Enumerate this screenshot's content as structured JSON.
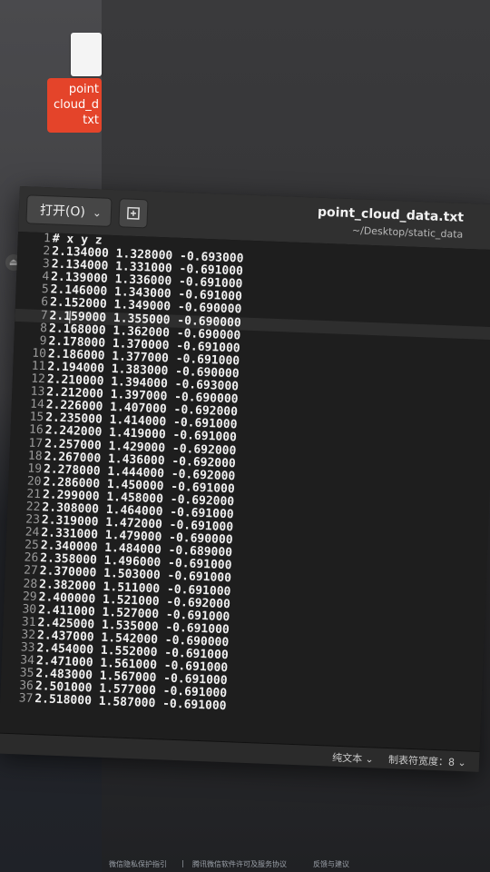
{
  "desktop": {
    "file_label": "point\ncloud_d\ntxt"
  },
  "editor_window": {
    "open_button": "打开(O)",
    "open_chevron": "chevron-down",
    "title": "point_cloud_data.txt",
    "path": "~/Desktop/static_data",
    "lines": [
      {
        "n": "1",
        "text": "# x y z"
      },
      {
        "n": "2",
        "text": "2.134000 1.328000 -0.693000"
      },
      {
        "n": "3",
        "text": "2.134000 1.331000 -0.691000"
      },
      {
        "n": "4",
        "text": "2.139000 1.336000 -0.691000"
      },
      {
        "n": "5",
        "text": "2.146000 1.343000 -0.691000"
      },
      {
        "n": "6",
        "text": "2.152000 1.349000 -0.690000"
      },
      {
        "n": "7",
        "text": "2.159000 1.355000 -0.690000"
      },
      {
        "n": "8",
        "text": "2.168000 1.362000 -0.690000"
      },
      {
        "n": "9",
        "text": "2.178000 1.370000 -0.691000"
      },
      {
        "n": "10",
        "text": "2.186000 1.377000 -0.691000"
      },
      {
        "n": "11",
        "text": "2.194000 1.383000 -0.690000"
      },
      {
        "n": "12",
        "text": "2.210000 1.394000 -0.693000"
      },
      {
        "n": "13",
        "text": "2.212000 1.397000 -0.690000"
      },
      {
        "n": "14",
        "text": "2.226000 1.407000 -0.692000"
      },
      {
        "n": "15",
        "text": "2.235000 1.414000 -0.691000"
      },
      {
        "n": "16",
        "text": "2.242000 1.419000 -0.691000"
      },
      {
        "n": "17",
        "text": "2.257000 1.429000 -0.692000"
      },
      {
        "n": "18",
        "text": "2.267000 1.436000 -0.692000"
      },
      {
        "n": "19",
        "text": "2.278000 1.444000 -0.692000"
      },
      {
        "n": "20",
        "text": "2.286000 1.450000 -0.691000"
      },
      {
        "n": "21",
        "text": "2.299000 1.458000 -0.692000"
      },
      {
        "n": "22",
        "text": "2.308000 1.464000 -0.691000"
      },
      {
        "n": "23",
        "text": "2.319000 1.472000 -0.691000"
      },
      {
        "n": "24",
        "text": "2.331000 1.479000 -0.690000"
      },
      {
        "n": "25",
        "text": "2.340000 1.484000 -0.689000"
      },
      {
        "n": "26",
        "text": "2.358000 1.496000 -0.691000"
      },
      {
        "n": "27",
        "text": "2.370000 1.503000 -0.691000"
      },
      {
        "n": "28",
        "text": "2.382000 1.511000 -0.691000"
      },
      {
        "n": "29",
        "text": "2.400000 1.521000 -0.692000"
      },
      {
        "n": "30",
        "text": "2.411000 1.527000 -0.691000"
      },
      {
        "n": "31",
        "text": "2.425000 1.535000 -0.691000"
      },
      {
        "n": "32",
        "text": "2.437000 1.542000 -0.690000"
      },
      {
        "n": "33",
        "text": "2.454000 1.552000 -0.691000"
      },
      {
        "n": "34",
        "text": "2.471000 1.561000 -0.691000"
      },
      {
        "n": "35",
        "text": "2.483000 1.567000 -0.691000"
      },
      {
        "n": "36",
        "text": "2.501000 1.577000 -0.691000"
      },
      {
        "n": "37",
        "text": "2.518000 1.587000 -0.691000"
      }
    ],
    "current_line": 7,
    "status": {
      "syntax": "纯文本 ⌄",
      "tab_width": "制表符宽度：8 ⌄"
    }
  },
  "footer": {
    "privacy": "微信隐私保护指引",
    "separator": "|",
    "license": "腾讯微信软件许可及服务协议",
    "feedback": "反馈与建议"
  }
}
